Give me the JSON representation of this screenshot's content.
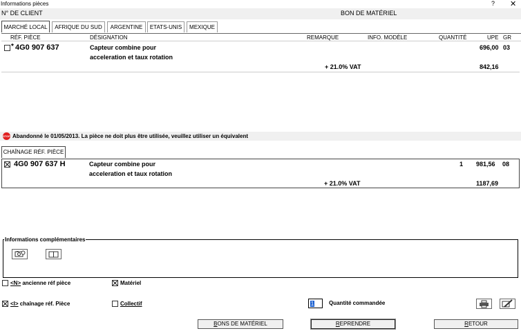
{
  "window": {
    "title": "Informations pièces",
    "help_label": "?",
    "close_label": "✕"
  },
  "header": {
    "client_label": "N° DE CLIENT",
    "bon_label": "BON DE MATÉRIEL"
  },
  "tabs": [
    {
      "label": "MARCHÉ LOCAL",
      "active": true
    },
    {
      "label": "AFRIQUE DU SUD",
      "active": false
    },
    {
      "label": "ARGENTINE",
      "active": false
    },
    {
      "label": "ETATS-UNIS",
      "active": false
    },
    {
      "label": "MEXIQUE",
      "active": false
    }
  ],
  "columns": {
    "ref": "RÉF. PIÈCE",
    "designation": "DÉSIGNATION",
    "remarque": "REMARQUE",
    "info": "INFO. MODÈLE",
    "quantite": "QUANTITÉ",
    "upe": "UPE",
    "gr": "GR"
  },
  "part": {
    "checked": false,
    "marker": "*",
    "ref": "4G0 907 637",
    "desc_line1": "Capteur combine pour",
    "desc_line2": "acceleration et taux rotation",
    "price": "696,00",
    "gr": "03",
    "vat_label": "+ 21.0% VAT",
    "vat_price": "842,16"
  },
  "warning": {
    "icon_text": "STOP",
    "text": "Abandonné le 01/05/2013. La pièce ne doit plus être utilisée, veuillez utiliser un équivalent"
  },
  "chain": {
    "tab_label": "CHAÎNAGE RÉF. PIÈCE",
    "checked": true,
    "ref": "4G0 907 637 H",
    "desc_line1": "Capteur combine pour",
    "desc_line2": "acceleration et taux rotation",
    "quantity": "1",
    "price": "981,56",
    "gr": "08",
    "vat_label": "+ 21.0% VAT",
    "vat_price": "1187,69"
  },
  "info_section": {
    "label": "Informations complémentaires"
  },
  "options": {
    "ancienne_key": "<N>",
    "ancienne_rest": " ancienne réf pièce",
    "ancienne_checked": false,
    "chainage_key": "<I>",
    "chainage_rest": " chaînage réf. Pièce",
    "chainage_checked": true,
    "materiel_label": "Matériel",
    "materiel_checked": true,
    "collectif_label": "Collectif",
    "collectif_checked": false,
    "quantite_label": "Quantité commandée",
    "quantite_value": "1"
  },
  "buttons": {
    "bons_first": "B",
    "bons_rest": "ONS DE MATÉRIEL",
    "reprendre_first": "R",
    "reprendre_rest": "EPRENDRE",
    "retour_first": "R",
    "retour_rest": "ETOUR"
  }
}
